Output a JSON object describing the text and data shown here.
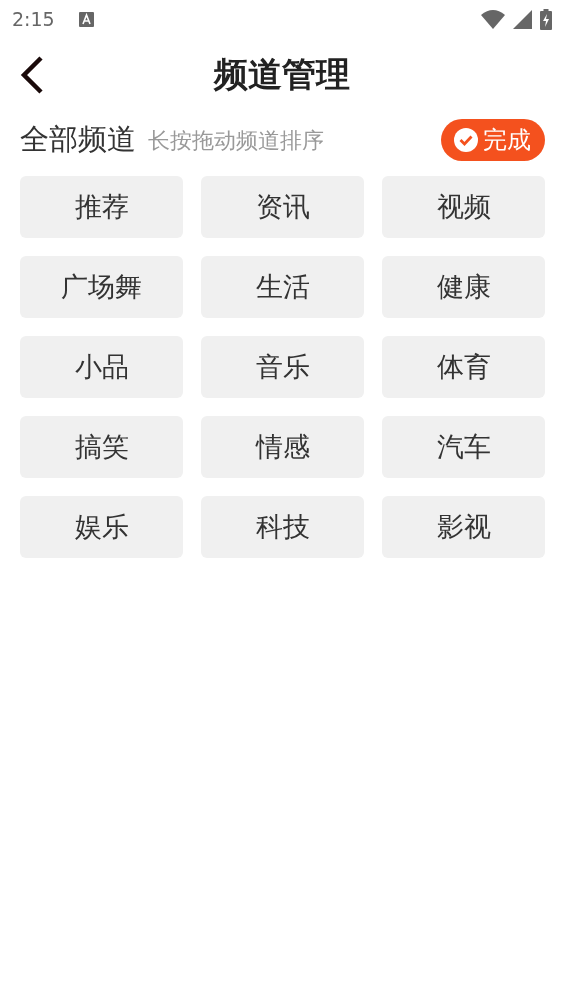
{
  "status_bar": {
    "time": "2:15"
  },
  "header": {
    "title": "频道管理"
  },
  "section": {
    "title": "全部频道",
    "hint": "长按拖动频道排序",
    "done_button": "完成"
  },
  "channels": [
    "推荐",
    "资讯",
    "视频",
    "广场舞",
    "生活",
    "健康",
    "小品",
    "音乐",
    "体育",
    "搞笑",
    "情感",
    "汽车",
    "娱乐",
    "科技",
    "影视"
  ]
}
